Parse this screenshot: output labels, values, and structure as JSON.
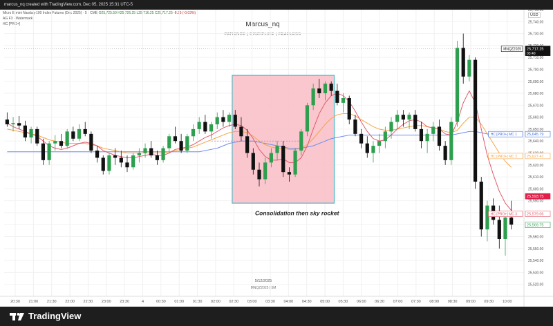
{
  "header": {
    "byline": "marcus_nq created with TradingView.com, Dec 05, 2025 15:31 UTC-5"
  },
  "legend": {
    "symbol_line": "Micro E-mini Nasdaq-100 Index Futures (Dec 2025) · 5 · CME",
    "ohlc": {
      "o": "O25,725.50",
      "h": "H25,726.25",
      "l": "L25,716.25",
      "c": "C25,717.25",
      "chg": "-8.25 (-0.03%)"
    },
    "line2": "AG F3 · Watermark",
    "line3": "HC [PRO+]"
  },
  "watermark": {
    "title": "Marcus_nq",
    "subtitle": "PATIENCE  |  DISCIPLINE  |  FEARLESS"
  },
  "annotation": "Consolidation then sky rocket",
  "footer": {
    "date": "5/12/2025",
    "symbol": "MNQZ2025  |  5M"
  },
  "currency": "USD",
  "brand": "TradingView",
  "colors": {
    "up": "#2e9e4f",
    "down": "#111111",
    "box_fill": "#f8c1c8",
    "box_border": "#4fb8c8",
    "ma_red": "#e05a6a",
    "ma_orange": "#f5a54a",
    "ma_blue": "#6c8cf0"
  },
  "price_tags": [
    {
      "label": "MNQZ2025",
      "value": "25,717.25",
      "sub": "03:40",
      "color": "#111111",
      "price": 25717.25
    },
    {
      "label": "HC [PRO+] MC 1",
      "value": "25,645.79",
      "color": "#3f6fe0",
      "price": 25645.79
    },
    {
      "label": "HC [PRO+] MC 2",
      "value": "25,627.47",
      "color": "#f5a54a",
      "price": 25627.47
    },
    {
      "label": "",
      "value": "25,593.75",
      "color": "#e0204a",
      "price": 25593.75,
      "filled": true
    },
    {
      "label": "HC [PRO+] MC 3",
      "value": "25,579.06",
      "color": "#e05a6a",
      "price": 25579.06
    },
    {
      "label": "",
      "value": "25,569.75",
      "color": "#2e9e4f",
      "price": 25569.75
    }
  ],
  "chart_data": {
    "type": "candlestick",
    "ylim": [
      25510,
      25750
    ],
    "y_ticks": [
      "25,750.00",
      "25,740.00",
      "25,730.00",
      "25,720.00",
      "25,710.00",
      "25,700.00",
      "25,690.00",
      "25,680.00",
      "25,670.00",
      "25,660.00",
      "25,650.00",
      "25,640.00",
      "25,630.00",
      "25,620.00",
      "25,610.00",
      "25,600.00",
      "25,590.00",
      "25,580.00",
      "25,570.00",
      "25,560.00",
      "25,550.00",
      "25,540.00",
      "25,530.00",
      "25,520.00"
    ],
    "x_ticks": [
      "20:30",
      "21:00",
      "21:30",
      "22:00",
      "22:30",
      "23:00",
      "23:30",
      "4",
      "00:30",
      "01:00",
      "01:30",
      "02:00",
      "02:30",
      "03:00",
      "03:30",
      "04:00",
      "04:30",
      "05:00",
      "05:30",
      "06:00",
      "06:30",
      "07:00",
      "07:30",
      "08:00",
      "08:30",
      "09:00",
      "09:30",
      "10:00"
    ],
    "candles": [
      [
        25658,
        25664,
        25652,
        25654
      ],
      [
        25654,
        25660,
        25648,
        25655
      ],
      [
        25655,
        25661,
        25650,
        25653
      ],
      [
        25653,
        25657,
        25640,
        25643
      ],
      [
        25643,
        25652,
        25638,
        25650
      ],
      [
        25650,
        25652,
        25636,
        25638
      ],
      [
        25638,
        25642,
        25620,
        25624
      ],
      [
        25624,
        25640,
        25620,
        25638
      ],
      [
        25638,
        25645,
        25632,
        25640
      ],
      [
        25640,
        25646,
        25634,
        25636
      ],
      [
        25636,
        25650,
        25634,
        25648
      ],
      [
        25648,
        25652,
        25640,
        25642
      ],
      [
        25642,
        25654,
        25640,
        25650
      ],
      [
        25650,
        25656,
        25644,
        25646
      ],
      [
        25646,
        25648,
        25630,
        25632
      ],
      [
        25632,
        25636,
        25622,
        25626
      ],
      [
        25626,
        25628,
        25612,
        25615
      ],
      [
        25615,
        25630,
        25612,
        25628
      ],
      [
        25628,
        25634,
        25620,
        25626
      ],
      [
        25626,
        25632,
        25618,
        25622
      ],
      [
        25622,
        25628,
        25614,
        25618
      ],
      [
        25618,
        25630,
        25616,
        25628
      ],
      [
        25628,
        25634,
        25622,
        25630
      ],
      [
        25630,
        25638,
        25626,
        25634
      ],
      [
        25634,
        25640,
        25626,
        25628
      ],
      [
        25628,
        25632,
        25620,
        25624
      ],
      [
        25624,
        25636,
        25622,
        25634
      ],
      [
        25634,
        25646,
        25630,
        25644
      ],
      [
        25644,
        25652,
        25638,
        25640
      ],
      [
        25640,
        25646,
        25630,
        25632
      ],
      [
        25632,
        25646,
        25630,
        25644
      ],
      [
        25644,
        25654,
        25640,
        25650
      ],
      [
        25650,
        25660,
        25646,
        25656
      ],
      [
        25656,
        25662,
        25646,
        25648
      ],
      [
        25648,
        25656,
        25642,
        25654
      ],
      [
        25654,
        25664,
        25650,
        25660
      ],
      [
        25660,
        25666,
        25652,
        25656
      ],
      [
        25656,
        25664,
        25652,
        25662
      ],
      [
        25662,
        25666,
        25650,
        25652
      ],
      [
        25652,
        25660,
        25640,
        25644
      ],
      [
        25644,
        25650,
        25626,
        25630
      ],
      [
        25630,
        25634,
        25612,
        25616
      ],
      [
        25616,
        25622,
        25602,
        25608
      ],
      [
        25608,
        25626,
        25604,
        25622
      ],
      [
        25622,
        25634,
        25618,
        25630
      ],
      [
        25630,
        25640,
        25624,
        25636
      ],
      [
        25636,
        25640,
        25610,
        25614
      ],
      [
        25614,
        25618,
        25606,
        25612
      ],
      [
        25612,
        25634,
        25610,
        25632
      ],
      [
        25632,
        25650,
        25628,
        25648
      ],
      [
        25648,
        25672,
        25644,
        25670
      ],
      [
        25670,
        25688,
        25666,
        25684
      ],
      [
        25684,
        25692,
        25676,
        25680
      ],
      [
        25680,
        25690,
        25674,
        25688
      ],
      [
        25688,
        25690,
        25678,
        25682
      ],
      [
        25682,
        25688,
        25670,
        25672
      ],
      [
        25672,
        25680,
        25664,
        25676
      ],
      [
        25676,
        25678,
        25654,
        25658
      ],
      [
        25658,
        25662,
        25644,
        25646
      ],
      [
        25646,
        25650,
        25634,
        25638
      ],
      [
        25638,
        25644,
        25626,
        25630
      ],
      [
        25630,
        25640,
        25622,
        25636
      ],
      [
        25636,
        25646,
        25630,
        25640
      ],
      [
        25640,
        25652,
        25634,
        25648
      ],
      [
        25648,
        25660,
        25642,
        25656
      ],
      [
        25656,
        25666,
        25650,
        25662
      ],
      [
        25662,
        25666,
        25652,
        25658
      ],
      [
        25658,
        25664,
        25650,
        25662
      ],
      [
        25662,
        25666,
        25648,
        25650
      ],
      [
        25650,
        25656,
        25634,
        25640
      ],
      [
        25640,
        25650,
        25630,
        25646
      ],
      [
        25646,
        25656,
        25640,
        25652
      ],
      [
        25652,
        25658,
        25632,
        25636
      ],
      [
        25636,
        25640,
        25620,
        25624
      ],
      [
        25624,
        25660,
        25620,
        25656
      ],
      [
        25656,
        25724,
        25652,
        25718
      ],
      [
        25718,
        25730,
        25688,
        25694
      ],
      [
        25694,
        25712,
        25690,
        25708
      ],
      [
        25708,
        25710,
        25600,
        25606
      ],
      [
        25606,
        25610,
        25560,
        25566
      ],
      [
        25566,
        25590,
        25556,
        25586
      ],
      [
        25586,
        25592,
        25570,
        25574
      ],
      [
        25574,
        25586,
        25550,
        25558
      ],
      [
        25558,
        25580,
        25544,
        25576
      ],
      [
        25576,
        25590,
        25566,
        25570
      ]
    ],
    "box": {
      "start_index": 38,
      "end_index": 54,
      "price_top": 25695,
      "price_bottom": 25588
    },
    "ma_red": [
      25655,
      25652,
      25650,
      25648,
      25646,
      25644,
      25640,
      25636,
      25634,
      25633,
      25634,
      25636,
      25638,
      25639,
      25638,
      25636,
      25632,
      25630,
      25628,
      25627,
      25626,
      25626,
      25627,
      25628,
      25629,
      25628,
      25628,
      25630,
      25633,
      25634,
      25635,
      25637,
      25640,
      25643,
      25645,
      25648,
      25651,
      25653,
      25654,
      25653,
      25649,
      25642,
      25633,
      25627,
      25624,
      25624,
      25625,
      25622,
      25622,
      25626,
      25636,
      25650,
      25663,
      25672,
      25678,
      25680,
      25678,
      25673,
      25665,
      25656,
      25648,
      25642,
      25640,
      25641,
      25645,
      25650,
      25654,
      25657,
      25658,
      25656,
      25652,
      25651,
      25650,
      25646,
      25645,
      25656,
      25672,
      25682,
      25672,
      25650,
      25628,
      25612,
      25598,
      25588,
      25582
    ],
    "ma_orange": [
      25650,
      25649,
      25648,
      25647,
      25646,
      25645,
      25643,
      25641,
      25640,
      25639,
      25638,
      25638,
      25638,
      25638,
      25637,
      25636,
      25634,
      25633,
      25632,
      25631,
      25630,
      25630,
      25630,
      25630,
      25630,
      25630,
      25630,
      25631,
      25632,
      25633,
      25634,
      25635,
      25637,
      25639,
      25641,
      25643,
      25645,
      25647,
      25648,
      25648,
      25647,
      25644,
      25640,
      25637,
      25635,
      25634,
      25634,
      25633,
      25633,
      25634,
      25637,
      25642,
      25648,
      25654,
      25659,
      25662,
      25663,
      25663,
      25661,
      25658,
      25655,
      25652,
      25650,
      25649,
      25649,
      25650,
      25651,
      25652,
      25653,
      25653,
      25652,
      25651,
      25650,
      25648,
      25647,
      25649,
      25655,
      25660,
      25660,
      25654,
      25646,
      25638,
      25630,
      25623,
      25618
    ],
    "ma_blue": [
      25631,
      25631,
      25631,
      25631,
      25631,
      25631,
      25631,
      25631,
      25631,
      25631,
      25631,
      25631,
      25631,
      25631,
      25631,
      25631,
      25631,
      25631,
      25631,
      25631,
      25631,
      25631,
      25631,
      25631,
      25631,
      25631,
      25631,
      25631,
      25631,
      25631,
      25631,
      25631,
      25631,
      25632,
      25633,
      25634,
      25636,
      25638,
      25639,
      25640,
      25640,
      25640,
      25639,
      25638,
      25637,
      25636,
      25635,
      25634,
      25634,
      25634,
      25635,
      25636,
      25638,
      25640,
      25642,
      25643,
      25644,
      25645,
      25645,
      25645,
      25645,
      25645,
      25645,
      25645,
      25645,
      25645,
      25645,
      25645,
      25645,
      25645,
      25645,
      25645,
      25645,
      25645,
      25645,
      25646,
      25647,
      25648,
      25648,
      25647,
      25646,
      25646,
      25646,
      25646,
      25646
    ]
  }
}
